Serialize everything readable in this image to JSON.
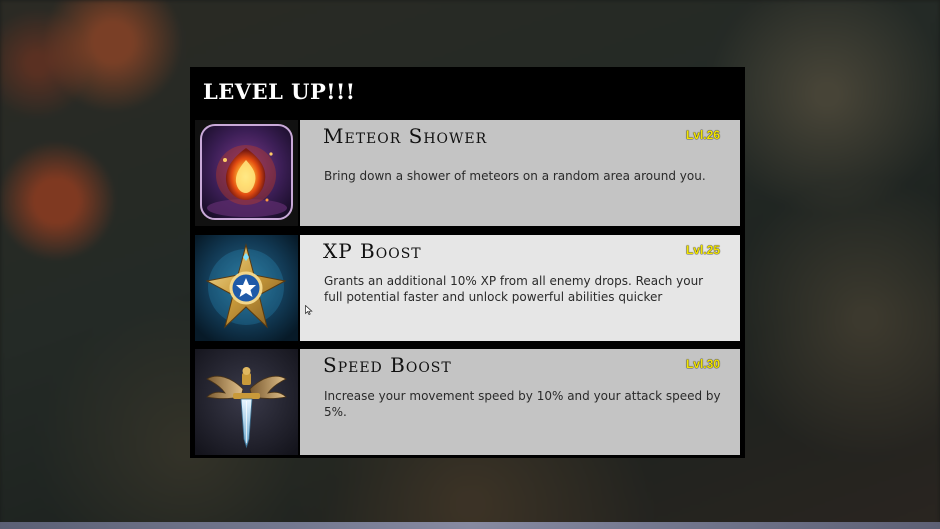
{
  "dialog": {
    "title": "LEVEL UP!!!"
  },
  "options": [
    {
      "name": "Meteor Shower",
      "level": "Lvl.26",
      "description": "Bring down a shower of meteors on a random area around you.",
      "icon": "meteor-icon"
    },
    {
      "name": "XP Boost",
      "level": "Lvl.25",
      "description": "Grants an additional 10% XP from all enemy drops. Reach your full potential faster and unlock powerful abilities quicker",
      "icon": "star-badge-icon"
    },
    {
      "name": "Speed Boost",
      "level": "Lvl.30",
      "description": "Increase your movement speed by 10% and your attack speed by 5%.",
      "icon": "winged-sword-icon"
    }
  ],
  "colors": {
    "level_text": "#f2e400",
    "card_default": "#c4c4c4",
    "card_highlight": "#e6e6e6",
    "panel_bg": "#000000"
  }
}
